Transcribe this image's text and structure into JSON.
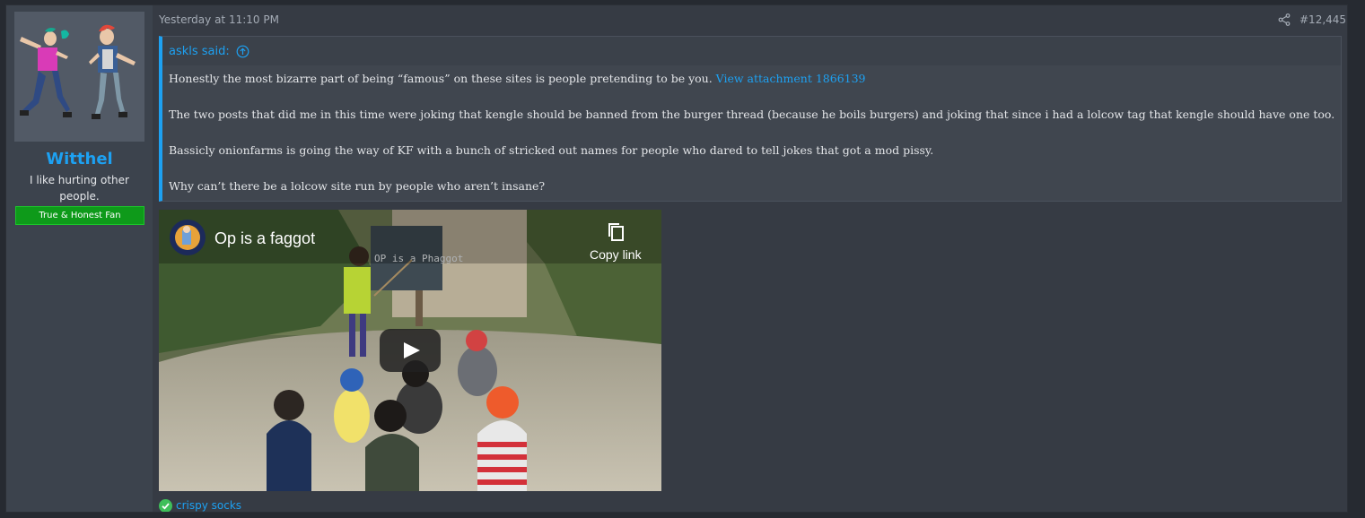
{
  "user": {
    "name": "Witthel",
    "title": "I like hurting other people.",
    "banner": "True & Honest Fan"
  },
  "post": {
    "date": "Yesterday at 11:10 PM",
    "number": "#12,445"
  },
  "quote": {
    "author": "askls said:",
    "line1_text": "Honestly the most bizarre part of being “famous” on these sites is people pretending to be you. ",
    "line1_link": "View attachment 1866139",
    "line2": "The two posts that did me in this time were joking that kengle should be banned from the burger thread (because he boils burgers) and joking that since i had a lolcow tag that kengle should have one too.",
    "line3": "Bassicly onionfarms is going the way of KF with a bunch of stricked out names for people who dared to tell jokes that got a mod pissy.",
    "line4": "Why can’t there be a lolcow site run by people who aren’t insane?"
  },
  "video": {
    "title": "Op is a faggot",
    "copy_label": "Copy link",
    "chalkboard_text": "OP is a Phaggot"
  },
  "reaction": {
    "user": "crispy socks"
  },
  "colors": {
    "accent": "#1da1f2",
    "banner_green": "#0e9a1a",
    "post_bg": "#363b44"
  },
  "icons": [
    "share-icon",
    "arrow-up-circle-icon",
    "copy-link-icon",
    "play-icon",
    "check-circle-icon"
  ]
}
